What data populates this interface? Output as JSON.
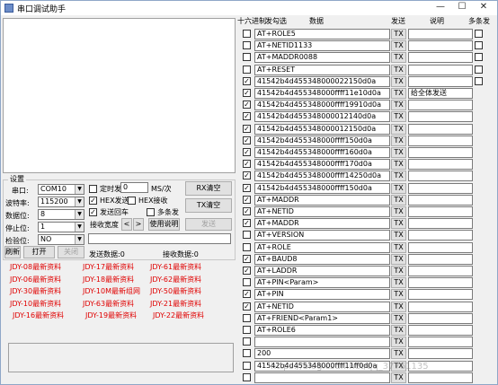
{
  "window": {
    "title": "串口调试助手",
    "min": "—",
    "max": "☐",
    "close": "✕"
  },
  "settings": {
    "group_label": "设置",
    "port_label": "串口:",
    "port_value": "COM10",
    "baud_label": "波特率:",
    "baud_value": "115200",
    "databits_label": "数据位:",
    "databits_value": "8",
    "stopbits_label": "停止位:",
    "stopbits_value": "1",
    "parity_label": "检验位:",
    "parity_value": "NO",
    "refresh_label": "刷新",
    "open_label": "打开",
    "close_label": "关闭",
    "timed_send_label": "定时发",
    "timed_send_value": "0",
    "timed_unit": "MS/次",
    "hex_send_label": "HEX发送",
    "hex_recv_label": "HEX接收",
    "send_newline_label": "发送回车",
    "multi_send_label": "多条发",
    "recv_width_label": "接收宽度",
    "prev_label": "<",
    "next_label": ">",
    "help_label": "使用说明",
    "send_label": "发送",
    "rx_clear_label": "RX清空",
    "tx_clear_label": "TX清空",
    "send_count_label": "发送数据:0",
    "recv_count_label": "接收数据:0",
    "timed_send_checked": false,
    "hex_send_checked": true,
    "hex_recv_checked": false,
    "send_newline_checked": true,
    "multi_send_checked": false
  },
  "shortcuts": [
    [
      "JDY-08最新资料",
      "JDY-17最新资料",
      "JDY-61最新资料"
    ],
    [
      "JDY-06最新资料",
      "JDY-18最新资料",
      "JDY-62最新资料"
    ],
    [
      "JDY-30最新资料",
      "JDY-10M最新组网",
      "JDY-50最新资料"
    ],
    [
      "JDY-10最新资料",
      "JDY-63最新资料",
      "JDY-21最新资料"
    ],
    [
      "JDY-16最新资料",
      "JDY-19最新资料",
      "JDY-22最新资料"
    ]
  ],
  "multi": {
    "header_hex": "十六进制",
    "header_send_select": "发勾选",
    "header_data": "数据",
    "header_send": "发送",
    "header_note": "说明",
    "header_multi": "多条发",
    "tx_label": "TX",
    "rows": [
      {
        "hex": false,
        "data": "AT+ROLE5",
        "note": "",
        "multi": true
      },
      {
        "hex": false,
        "data": "AT+NETID1133",
        "note": "",
        "multi": true
      },
      {
        "hex": false,
        "data": "AT+MADDR0088",
        "note": "",
        "multi": true
      },
      {
        "hex": false,
        "data": "AT+RESET",
        "note": "",
        "multi": true
      },
      {
        "hex": true,
        "data": "41542b4d455348000022150d0a",
        "note": "",
        "multi": true
      },
      {
        "hex": true,
        "data": "41542b4d455348000ffff11e10d0a",
        "note": "给全体发送",
        "multi": false
      },
      {
        "hex": true,
        "data": "41542b4d455348000ffff19910d0a",
        "note": "",
        "multi": false
      },
      {
        "hex": true,
        "data": "41542b4d455348000012140d0a",
        "note": "",
        "multi": false
      },
      {
        "hex": true,
        "data": "41542b4d455348000012150d0a",
        "note": "",
        "multi": false
      },
      {
        "hex": true,
        "data": "41542b4d455348000ffff150d0a",
        "note": "",
        "multi": false
      },
      {
        "hex": true,
        "data": "41542b4d455348000ffff160d0a",
        "note": "",
        "multi": false
      },
      {
        "hex": true,
        "data": "41542b4d455348000ffff170d0a",
        "note": "",
        "multi": false
      },
      {
        "hex": true,
        "data": "41542b4d455348000ffff14250d0a",
        "note": "",
        "multi": false
      },
      {
        "hex": true,
        "data": "41542b4d455348000ffff150d0a",
        "note": "",
        "multi": false
      },
      {
        "hex": true,
        "data": "AT+MADDR",
        "note": "",
        "multi": false
      },
      {
        "hex": true,
        "data": "AT+NETID",
        "note": "",
        "multi": false
      },
      {
        "hex": true,
        "data": "AT+MADDR",
        "note": "",
        "multi": false
      },
      {
        "hex": false,
        "data": "AT+VERSION",
        "note": "",
        "multi": false
      },
      {
        "hex": false,
        "data": "AT+ROLE",
        "note": "",
        "multi": false
      },
      {
        "hex": true,
        "data": "AT+BAUD8",
        "note": "",
        "multi": false
      },
      {
        "hex": true,
        "data": "AT+LADDR",
        "note": "",
        "multi": false
      },
      {
        "hex": false,
        "data": "AT+PIN<Param>",
        "note": "",
        "multi": false
      },
      {
        "hex": true,
        "data": "AT+PIN",
        "note": "",
        "multi": false
      },
      {
        "hex": true,
        "data": "AT+NETID",
        "note": "",
        "multi": false
      },
      {
        "hex": false,
        "data": "AT+FRIEND<Param1>",
        "note": "",
        "multi": false
      },
      {
        "hex": false,
        "data": "AT+ROLE6",
        "note": "",
        "multi": false
      },
      {
        "hex": false,
        "data": "",
        "note": "",
        "multi": false
      },
      {
        "hex": false,
        "data": "200",
        "note": "",
        "multi": false
      },
      {
        "hex": false,
        "data": "41542b4d455348000ffff11ff0d0a",
        "note": "",
        "multi": false
      },
      {
        "hex": false,
        "data": "",
        "note": "",
        "multi": false
      }
    ]
  },
  "watermark": "https://blog.csdn.net/qq_37761135"
}
